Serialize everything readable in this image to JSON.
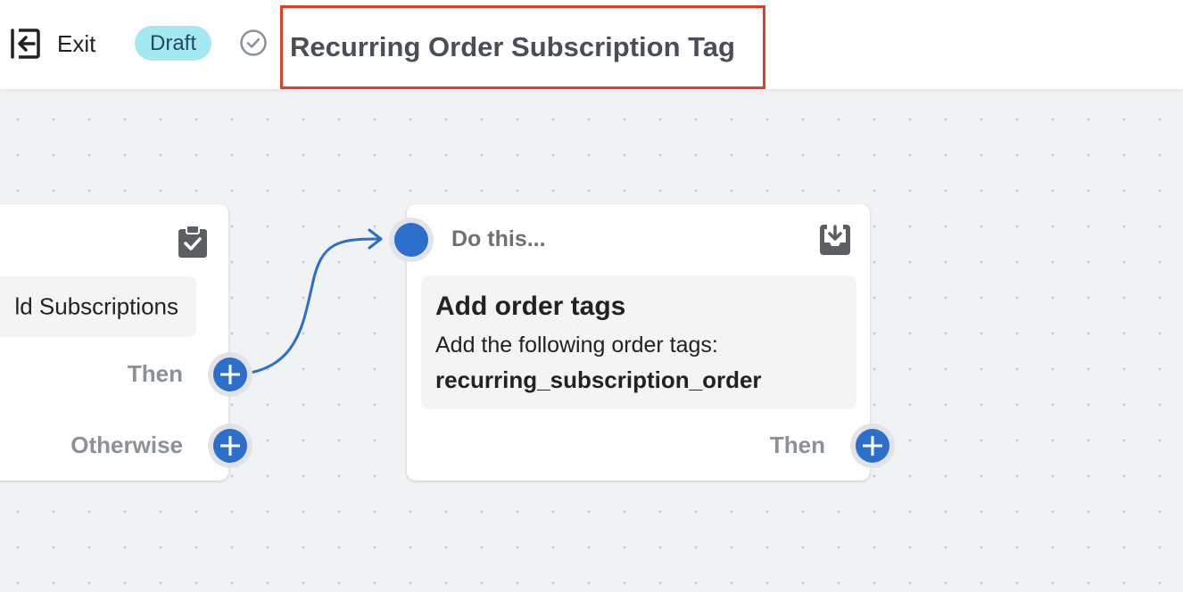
{
  "header": {
    "exit_label": "Exit",
    "status_badge": "Draft",
    "workflow_title": "Recurring Order Subscription Tag"
  },
  "condition_card": {
    "condition_text": "ld Subscriptions",
    "then_label": "Then",
    "otherwise_label": "Otherwise",
    "icon": "clipboard-check-icon"
  },
  "action_card": {
    "heading": "Do this...",
    "icon": "tray-download-icon",
    "action_title": "Add order tags",
    "action_description": "Add the following order tags:",
    "action_tag": "recurring_subscription_order",
    "then_label": "Then"
  },
  "colors": {
    "accent": "#2c6ecb",
    "badge_bg": "#a4e8f2",
    "highlight_border": "#e0402a",
    "canvas_bg": "#f1f2f4"
  }
}
